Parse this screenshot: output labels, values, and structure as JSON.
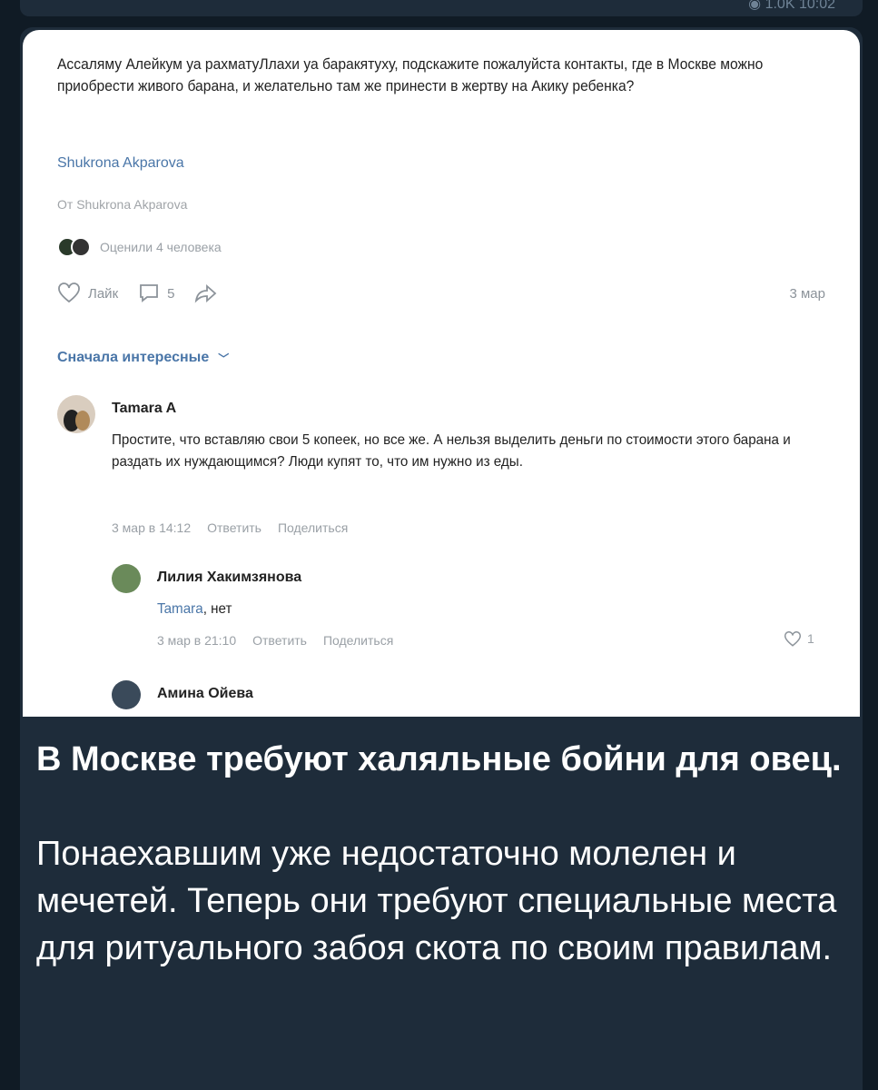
{
  "meta": {
    "views": "1.0K",
    "time": "10:02"
  },
  "screenshot": {
    "question": "Ассаляму Алейкум уа рахматуЛлахи уа баракятуху, подскажите пожалуйста контакты, где в Москве можно приобрести живого барана, и желательно там же принести в жертву на Акику ребенка?",
    "author": "Shukrona Akparova",
    "from": "От Shukrona Akparova",
    "rated": "Оценили 4 человека",
    "like_label": "Лайк",
    "comments_count": "5",
    "post_date": "3 мар",
    "sort_label": "Сначала интересные",
    "comments": [
      {
        "name": "Tamara A",
        "text": "Простите, что вставляю свои 5 копеек, но все же. А нельзя выделить деньги по стоимости этого барана и раздать их нуждающимся? Люди купят то, что им нужно из еды.",
        "date": "3 мар в 14:12",
        "reply": "Ответить",
        "share": "Поделиться"
      },
      {
        "name": "Лилия Хакимзянова",
        "reply_to": "Tamara",
        "text": ", нет",
        "date": "3 мар в 21:10",
        "reply": "Ответить",
        "share": "Поделиться",
        "likes": "1"
      },
      {
        "name": "Амина Ойева"
      }
    ]
  },
  "caption": {
    "title": "В Москве требуют халяльные бойни для овец.",
    "body": "Понаехавшим уже недостаточно молелен и мечетей. Теперь они требуют специальные места для ритуального забоя скота по своим правилам."
  }
}
